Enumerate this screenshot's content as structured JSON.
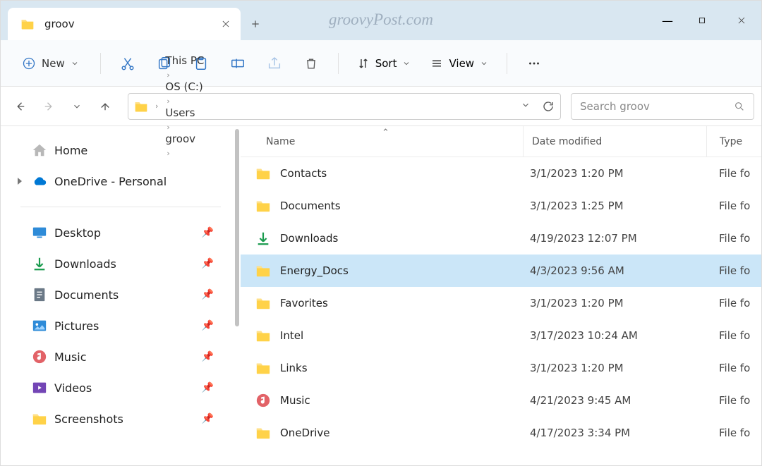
{
  "tab": {
    "title": "groov"
  },
  "watermark": "groovyPost.com",
  "toolbar": {
    "new_label": "New",
    "sort_label": "Sort",
    "view_label": "View"
  },
  "breadcrumbs": [
    "This PC",
    "OS (C:)",
    "Users",
    "groov"
  ],
  "search": {
    "placeholder": "Search groov"
  },
  "sidebar": {
    "home": "Home",
    "onedrive": "OneDrive - Personal",
    "pinned": [
      "Desktop",
      "Downloads",
      "Documents",
      "Pictures",
      "Music",
      "Videos",
      "Screenshots"
    ]
  },
  "columns": {
    "name": "Name",
    "date": "Date modified",
    "type": "Type"
  },
  "files": [
    {
      "name": "Contacts",
      "date": "3/1/2023 1:20 PM",
      "type": "File fo",
      "kind": "folder"
    },
    {
      "name": "Documents",
      "date": "3/1/2023 1:25 PM",
      "type": "File fo",
      "kind": "folder"
    },
    {
      "name": "Downloads",
      "date": "4/19/2023 12:07 PM",
      "type": "File fo",
      "kind": "download"
    },
    {
      "name": "Energy_Docs",
      "date": "4/3/2023 9:56 AM",
      "type": "File fo",
      "kind": "folder",
      "selected": true
    },
    {
      "name": "Favorites",
      "date": "3/1/2023 1:20 PM",
      "type": "File fo",
      "kind": "folder"
    },
    {
      "name": "Intel",
      "date": "3/17/2023 10:24 AM",
      "type": "File fo",
      "kind": "folder"
    },
    {
      "name": "Links",
      "date": "3/1/2023 1:20 PM",
      "type": "File fo",
      "kind": "folder"
    },
    {
      "name": "Music",
      "date": "4/21/2023 9:45 AM",
      "type": "File fo",
      "kind": "music"
    },
    {
      "name": "OneDrive",
      "date": "4/17/2023 3:34 PM",
      "type": "File fo",
      "kind": "folder"
    }
  ]
}
